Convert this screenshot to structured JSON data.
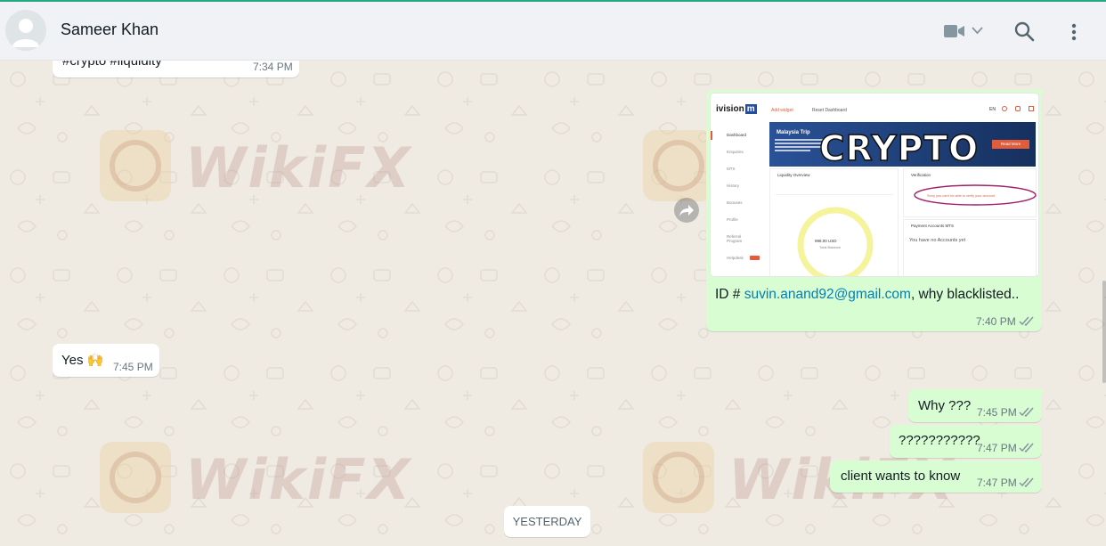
{
  "header": {
    "contact_name": "Sameer Khan",
    "icons": [
      "avatar-icon",
      "video-call-icon",
      "chevron-down-icon",
      "search-icon",
      "menu-icon"
    ]
  },
  "watermark": "WikiFX",
  "messages": [
    {
      "dir": "in",
      "text": "#crypto #liquidity",
      "time": "7:34 PM"
    },
    {
      "dir": "out",
      "type": "image",
      "caption_prefix": "ID # ",
      "caption_link": "suvin.anand92@gmail.com",
      "caption_suffix": ", why blacklisted..",
      "time": "7:40 PM",
      "status": "read"
    },
    {
      "dir": "in",
      "text": "Yes 🙌",
      "time": "7:45 PM"
    },
    {
      "dir": "out",
      "text": "Why ???",
      "time": "7:45 PM",
      "status": "read"
    },
    {
      "dir": "out",
      "text": "???????????",
      "time": "7:47 PM",
      "status": "read"
    },
    {
      "dir": "out",
      "text": "client wants to know",
      "time": "7:47 PM",
      "status": "read"
    }
  ],
  "date_divider": "YESTERDAY",
  "shared_image": {
    "logo": "ivision",
    "logo_badge": "m",
    "top_links": [
      "Add widget",
      "Reset Dashboard"
    ],
    "lang": "EN",
    "sidebar": [
      "Dashboard",
      "Enquiries",
      "MTS",
      "History",
      "Bonuses",
      "Profile",
      "Referral Program",
      "Helpdesk"
    ],
    "banner_title": "Malaysia Trip",
    "banner_word": "CRYPTO",
    "banner_button": "Read More",
    "panel_liquidity": "Liquidity Overview",
    "panel_verification": "Verification",
    "verification_text": "Sorry you can't be able to verify your account",
    "panel_payment": "Payment Accounts MTS",
    "payment_text": "You have no Accounts yet",
    "gauge_value": "998.00 USD",
    "gauge_label": "Total Balance"
  }
}
